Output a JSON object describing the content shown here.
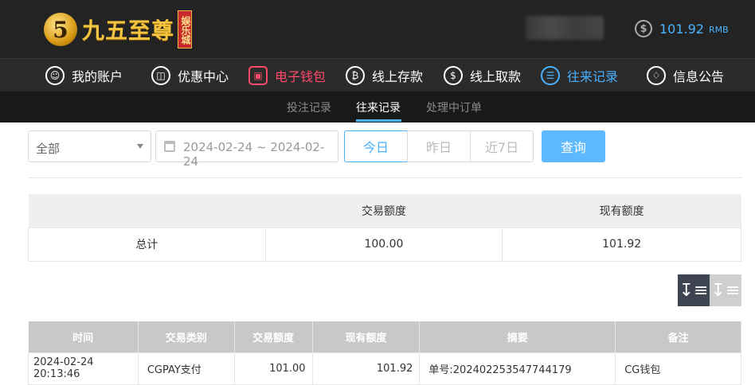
{
  "header": {
    "logo_mark": "5",
    "logo_name": "九五至尊",
    "logo_sub": "娱乐城",
    "balance": {
      "icon": "dollar-circle-icon",
      "amount": "101.92",
      "unit": "RMB"
    }
  },
  "nav": {
    "items": [
      {
        "label": "我的账户",
        "icon": "user-icon"
      },
      {
        "label": "优惠中心",
        "icon": "gift-icon"
      },
      {
        "label": "电子钱包",
        "icon": "wallet-icon"
      },
      {
        "label": "线上存款",
        "icon": "deposit-icon"
      },
      {
        "label": "线上取款",
        "icon": "withdraw-icon"
      },
      {
        "label": "往来记录",
        "icon": "records-icon"
      },
      {
        "label": "信息公告",
        "icon": "bell-icon"
      }
    ]
  },
  "subnav": {
    "items": [
      {
        "label": "投注记录"
      },
      {
        "label": "往来记录"
      },
      {
        "label": "处理中订单"
      }
    ],
    "active": "往来记录"
  },
  "filters": {
    "type_select": "全部",
    "date_range": "2024-02-24 ~ 2024-02-24",
    "segments": [
      "今日",
      "昨日",
      "近7日"
    ],
    "active_segment": "今日",
    "query_label": "查询"
  },
  "summary": {
    "headers": [
      "",
      "交易额度",
      "现有额度"
    ],
    "row": {
      "label": "总计",
      "amount": "100.00",
      "balance": "101.92"
    }
  },
  "transactions": {
    "headers": [
      "时间",
      "交易类别",
      "交易额度",
      "现有额度",
      "摘要",
      "备注"
    ],
    "rows": [
      {
        "time": "2024-02-24 20:13:46",
        "category": "CGPAY支付",
        "amount": "101.00",
        "balance": "101.92",
        "summary": "单号:202402253547744179",
        "note": "CG钱包"
      }
    ]
  },
  "colors": {
    "accent": "#48b0ff",
    "wallet_active": "#ff4a6a",
    "topbar": "#232323"
  }
}
